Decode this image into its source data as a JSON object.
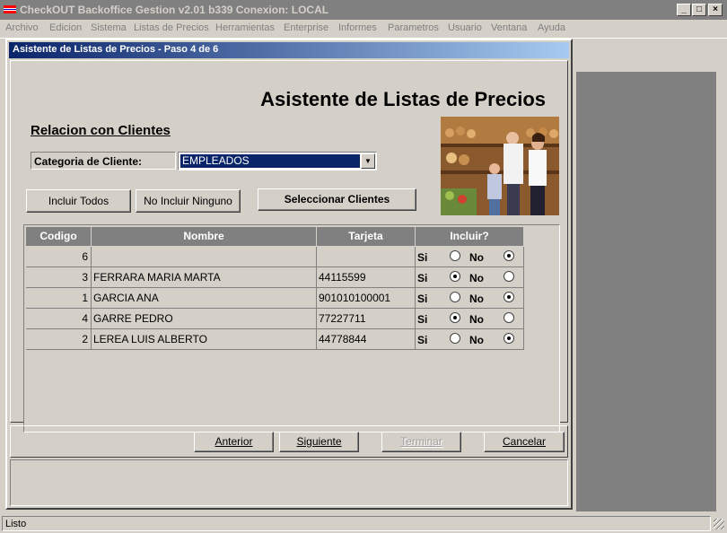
{
  "window": {
    "title": "CheckOUT Backoffice Gestion v2.01 b339 Conexion: LOCAL",
    "controls": [
      "_",
      "□",
      "×"
    ]
  },
  "menu": [
    "Archivo",
    "Edicion",
    "Sistema",
    "Listas de Precios",
    "Herramientas",
    "Enterprise",
    "Informes",
    "Parametros",
    "Usuario",
    "Ventana",
    "Ayuda"
  ],
  "dialog": {
    "title": "Asistente de Listas de Precios - Paso 4 de 6",
    "heading": "Asistente de Listas de Precios",
    "section": "Relacion con Clientes",
    "category_label": "Categoria de Cliente:",
    "category_value": "EMPLEADOS",
    "buttons": {
      "include_all": "Incluir Todos",
      "include_none": "No Incluir Ninguno",
      "select_clients": "Seleccionar Clientes"
    },
    "nav": {
      "prev": "Anterior",
      "next": "Siguiente",
      "finish": "Terminar",
      "cancel": "Cancelar"
    }
  },
  "table": {
    "headers": [
      "Codigo",
      "Nombre",
      "Tarjeta",
      "Incluir?"
    ],
    "yes_label": "Si",
    "no_label": "No",
    "rows": [
      {
        "codigo": "6",
        "nombre": "",
        "tarjeta": "",
        "incluir": false
      },
      {
        "codigo": "3",
        "nombre": "FERRARA MARIA MARTA",
        "tarjeta": "44115599",
        "incluir": true
      },
      {
        "codigo": "1",
        "nombre": "GARCIA ANA",
        "tarjeta": "901010100001",
        "incluir": false
      },
      {
        "codigo": "4",
        "nombre": "GARRE PEDRO",
        "tarjeta": "77227711",
        "incluir": true
      },
      {
        "codigo": "2",
        "nombre": "LEREA LUIS ALBERTO",
        "tarjeta": "44778844",
        "incluir": false
      }
    ]
  },
  "status": "Listo",
  "colors": {
    "title_active_start": "#0a246a",
    "title_active_end": "#a6caf0",
    "face": "#d4d0c8",
    "header_bg": "#808080"
  }
}
